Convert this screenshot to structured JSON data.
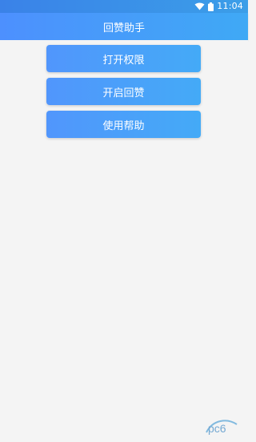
{
  "status_bar": {
    "time": "11:04",
    "icons": [
      "wifi-icon",
      "battery-icon"
    ]
  },
  "app_bar": {
    "title": "回赞助手"
  },
  "actions": {
    "open_permission_label": "打开权限",
    "start_reply_label": "开启回赞",
    "help_label": "使用帮助"
  },
  "watermark": {
    "text": "pc6",
    "icon": "pc6-watermark-logo"
  },
  "colors": {
    "status_bar": "#3a82e8",
    "app_bar_start": "#4d90fe",
    "app_bar_end": "#3fa9f5",
    "button_start": "#5196fc",
    "button_end": "#44aaf7",
    "background": "#f4f4f4",
    "text": "#ffffff"
  }
}
